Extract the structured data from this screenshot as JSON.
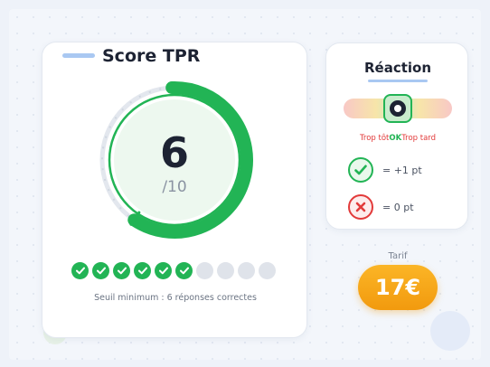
{
  "score": {
    "title": "Score TPR",
    "value": "6",
    "max_label": "/10",
    "fraction": 0.6,
    "answers": [
      true,
      true,
      true,
      true,
      true,
      true,
      false,
      false,
      false,
      false
    ],
    "threshold_text": "Seuil minimum : 6 réponses correctes"
  },
  "reaction": {
    "title": "Réaction",
    "early_label": "Trop tôt",
    "ok_label": "OK",
    "late_label": "Trop tard",
    "correct_text": "= +1 pt",
    "wrong_text": "= 0 pt"
  },
  "tarif": {
    "label": "Tarif",
    "price": "17€"
  },
  "colors": {
    "success": "#22b455",
    "error": "#e23a3a",
    "accent": "#f29a0e",
    "inactive": "#dfe3ea"
  },
  "icons": [
    "check-icon",
    "cross-icon",
    "target-icon"
  ]
}
